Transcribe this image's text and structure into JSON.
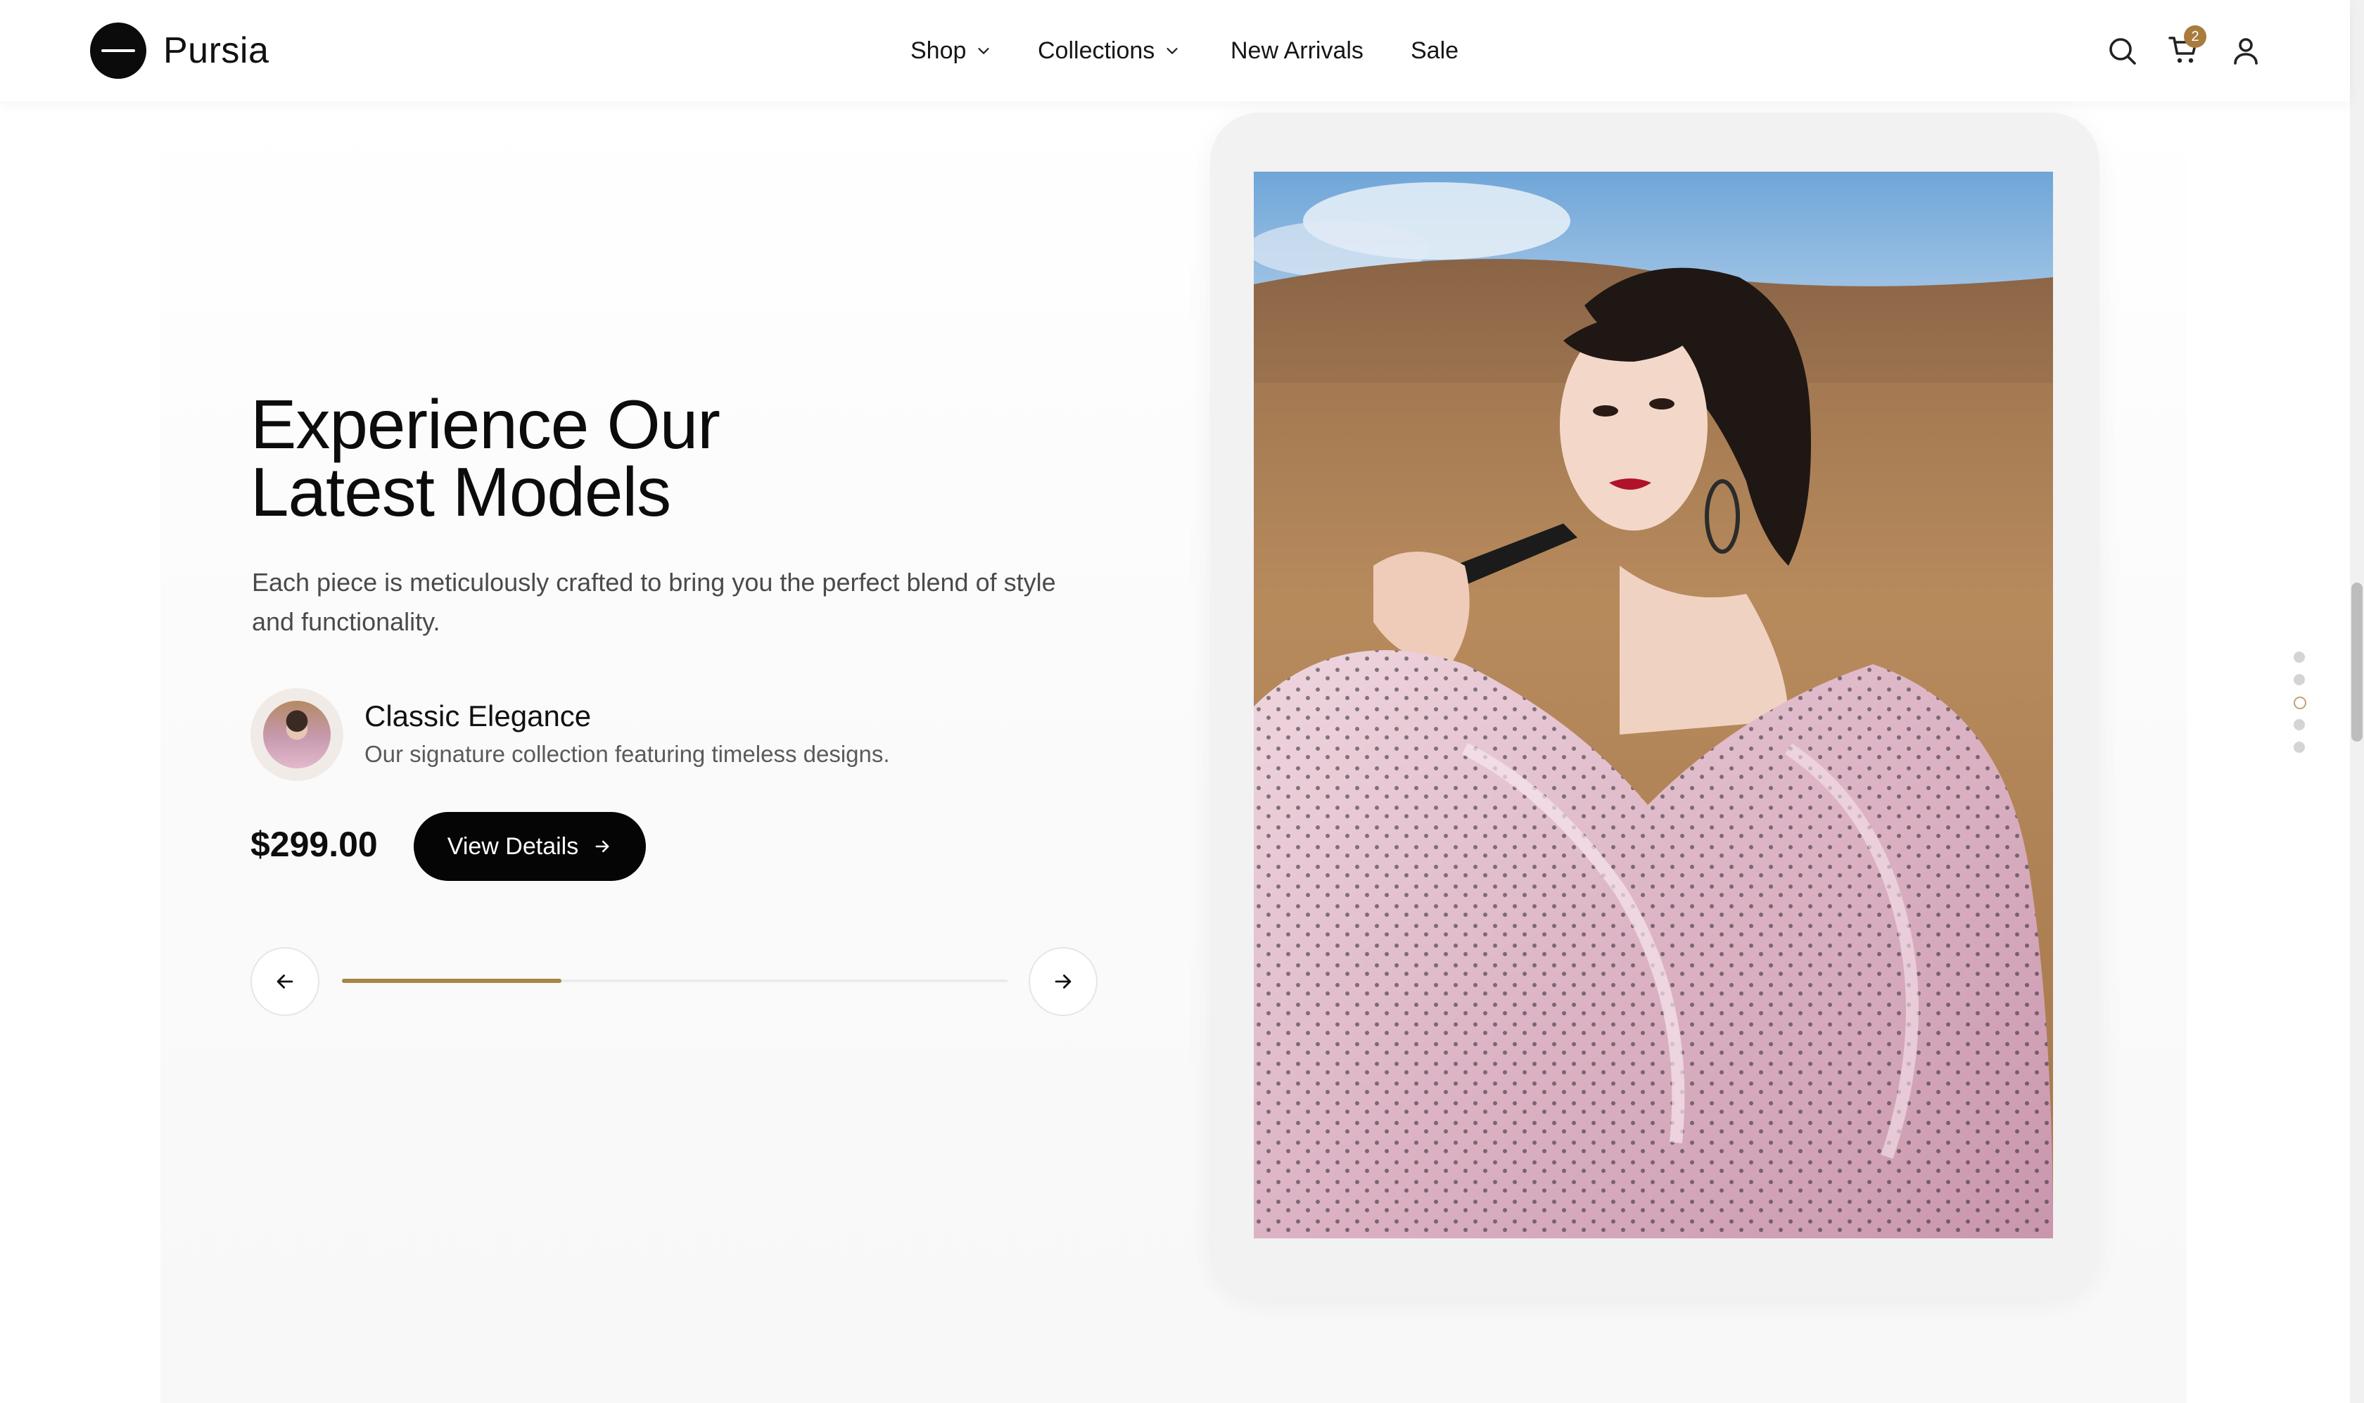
{
  "header": {
    "brand": "Pursia",
    "nav": [
      {
        "label": "Shop",
        "dropdown": true
      },
      {
        "label": "Collections",
        "dropdown": true
      },
      {
        "label": "New Arrivals",
        "dropdown": false
      },
      {
        "label": "Sale",
        "dropdown": false
      }
    ],
    "icons": [
      "search-icon",
      "cart-icon",
      "user-icon"
    ],
    "cart_count": "2"
  },
  "hero": {
    "headline_line1": "Experience Our",
    "headline_line2": "Latest Models",
    "description": "Each piece is meticulously crafted to bring you the perfect blend of style and functionality.",
    "collection": {
      "title": "Classic Elegance",
      "subtitle": "Our signature collection featuring timeless designs."
    },
    "price": "$299.00",
    "cta_label": "View Details",
    "slider_progress": 0.33
  },
  "colors": {
    "accent": "#a48646",
    "badge": "#a97b3c",
    "primary": "#050505",
    "background": "#ffffff"
  }
}
